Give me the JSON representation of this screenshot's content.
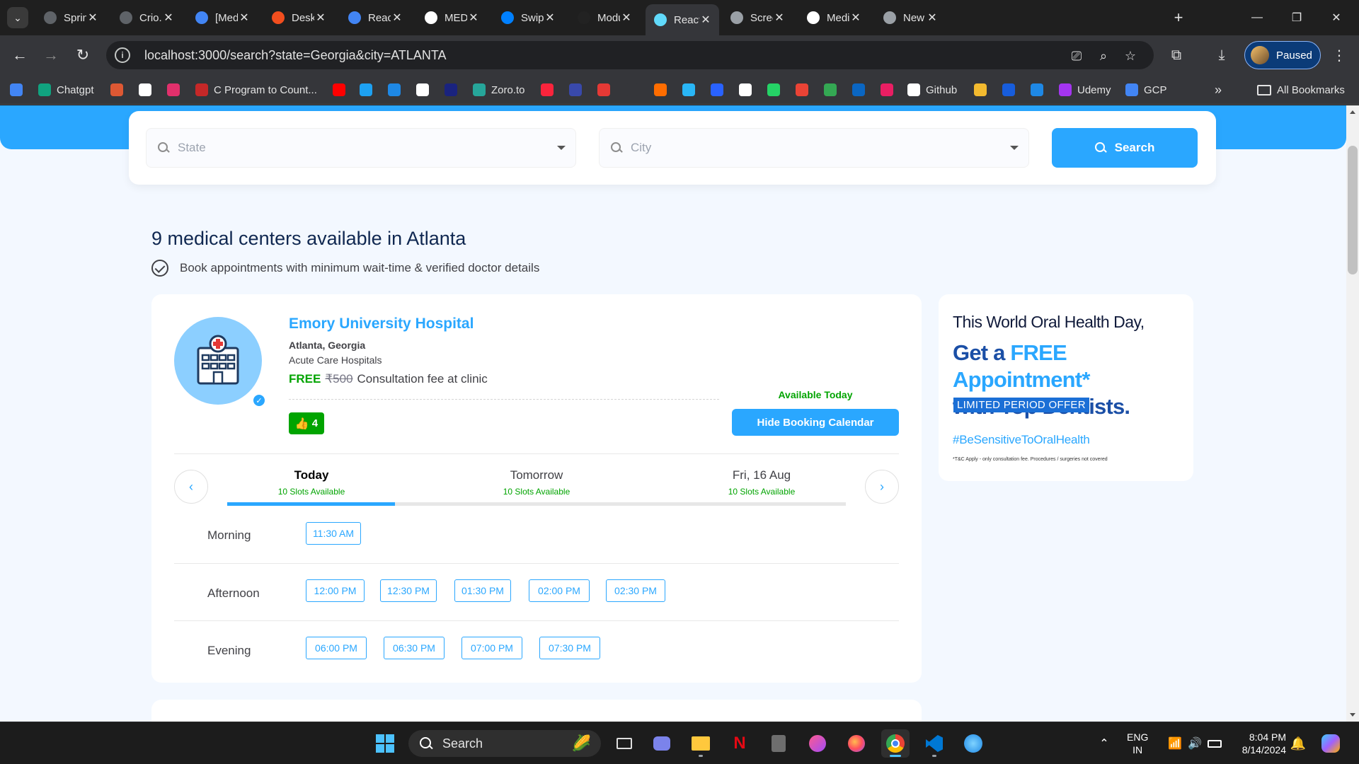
{
  "browser": {
    "tabs": [
      {
        "title": "Sprint",
        "icon": "generic-site-icon",
        "color": "#5f6368"
      },
      {
        "title": "Crio.Do",
        "icon": "generic-site-icon",
        "color": "#5f6368"
      },
      {
        "title": "[Medif",
        "icon": "google-docs-icon",
        "color": "#4285f4"
      },
      {
        "title": "Deskto",
        "icon": "figma-icon",
        "color": "#f24e1e"
      },
      {
        "title": "ReactJ",
        "icon": "google-docs-icon",
        "color": "#4285f4"
      },
      {
        "title": "MEDIF",
        "icon": "github-icon",
        "color": "#ffffff"
      },
      {
        "title": "Swiper",
        "icon": "swiper-icon",
        "color": "#0080ff"
      },
      {
        "title": "Modul",
        "icon": "generic-site-icon",
        "color": "#222222"
      },
      {
        "title": "React",
        "icon": "react-icon",
        "color": "#61dafb",
        "active": true
      },
      {
        "title": "Screen",
        "icon": "camera-icon",
        "color": "#9aa0a6"
      },
      {
        "title": "MediC",
        "icon": "github-icon",
        "color": "#ffffff"
      },
      {
        "title": "New Ta",
        "icon": "chrome-icon",
        "color": "#9aa0a6"
      }
    ],
    "url": "localhost:3000/search?state=Georgia&city=ATLANTA",
    "profile_label": "Paused",
    "bookmarks": [
      {
        "label": "",
        "icon": "google-icon",
        "color": "#4285f4"
      },
      {
        "label": "Chatgpt",
        "icon": "chatgpt-icon",
        "color": "#10a37f"
      },
      {
        "label": "",
        "icon": "duckduckgo-icon",
        "color": "#de5833"
      },
      {
        "label": "",
        "icon": "amazon-icon",
        "color": "#ffffff"
      },
      {
        "label": "",
        "icon": "instagram-icon",
        "color": "#e1306c"
      },
      {
        "label": "C Program to Count...",
        "icon": "tc-icon",
        "color": "#c62828"
      },
      {
        "label": "",
        "icon": "youtube-icon",
        "color": "#ff0000"
      },
      {
        "label": "",
        "icon": "twitter-icon",
        "color": "#1da1f2"
      },
      {
        "label": "",
        "icon": "play-icon",
        "color": "#1e88e5"
      },
      {
        "label": "",
        "icon": "site-icon",
        "color": "#ffffff"
      },
      {
        "label": "",
        "icon": "bh-icon",
        "color": "#1a237e"
      },
      {
        "label": "Zoro.to",
        "icon": "zoro-icon",
        "color": "#26a69a"
      },
      {
        "label": "",
        "icon": "music-icon",
        "color": "#fa243c"
      },
      {
        "label": "",
        "icon": "chart-icon",
        "color": "#3949ab"
      },
      {
        "label": "",
        "icon": "adobe-icon",
        "color": "#e53935"
      },
      {
        "label": "",
        "icon": "h-icon",
        "color": "#35363a"
      },
      {
        "label": "",
        "icon": "b-icon",
        "color": "#ff6d00"
      },
      {
        "label": "",
        "icon": "fly-icon",
        "color": "#29b6f6"
      },
      {
        "label": "",
        "icon": "kotlin-icon",
        "color": "#2962ff"
      },
      {
        "label": "",
        "icon": "w-icon",
        "color": "#ffffff"
      },
      {
        "label": "",
        "icon": "whatsapp-icon",
        "color": "#25d366"
      },
      {
        "label": "",
        "icon": "gmail-icon",
        "color": "#ea4335"
      },
      {
        "label": "",
        "icon": "drive-icon",
        "color": "#34a853"
      },
      {
        "label": "",
        "icon": "linkedin-icon",
        "color": "#0a66c2"
      },
      {
        "label": "",
        "icon": "swirl-icon",
        "color": "#e91e63"
      },
      {
        "label": "Github",
        "icon": "github-icon",
        "color": "#ffffff"
      },
      {
        "label": "",
        "icon": "binance-icon",
        "color": "#f3ba2f"
      },
      {
        "label": "",
        "icon": "bitwarden-icon",
        "color": "#175ddc"
      },
      {
        "label": "",
        "icon": "k-icon",
        "color": "#1e88e5"
      },
      {
        "label": "Udemy",
        "icon": "udemy-icon",
        "color": "#a435f0"
      },
      {
        "label": "GCP",
        "icon": "gcp-icon",
        "color": "#4285f4"
      }
    ],
    "all_bookmarks_label": "All Bookmarks"
  },
  "search": {
    "state_placeholder": "State",
    "city_placeholder": "City",
    "button_label": "Search"
  },
  "results": {
    "heading": "9 medical centers available in Atlanta",
    "subheading": "Book appointments with minimum wait-time & verified doctor details"
  },
  "center": {
    "name": "Emory University Hospital",
    "location": "Atlanta, Georgia",
    "type": "Acute Care Hospitals",
    "fee_free": "FREE",
    "fee_original": "₹500",
    "fee_text": "Consultation fee at clinic",
    "likes": "4",
    "availability": "Available Today",
    "calendar_button": "Hide Booking Calendar",
    "days": [
      {
        "label": "Today",
        "slots": "10 Slots Available"
      },
      {
        "label": "Tomorrow",
        "slots": "10 Slots Available"
      },
      {
        "label": "Fri, 16 Aug",
        "slots": "10 Slots Available"
      }
    ],
    "periods": [
      {
        "label": "Morning",
        "times": [
          "11:30 AM"
        ]
      },
      {
        "label": "Afternoon",
        "times": [
          "12:00 PM",
          "12:30 PM",
          "01:30 PM",
          "02:00 PM",
          "02:30 PM"
        ]
      },
      {
        "label": "Evening",
        "times": [
          "06:00 PM",
          "06:30 PM",
          "07:00 PM",
          "07:30 PM"
        ]
      }
    ]
  },
  "ad": {
    "line1": "This World Oral Health Day,",
    "line2a": "Get a ",
    "line2b": "FREE Appointment*",
    "line3": "with Top Dentists.",
    "badge": "LIMITED PERIOD OFFER",
    "hashtag": "#BeSensitiveToOralHealth",
    "fineprint": "*T&C Apply - only consultation fee. Procedures / surgeries not covered"
  },
  "taskbar": {
    "search_label": "Search",
    "lang_line1": "ENG",
    "lang_line2": "IN",
    "time": "8:04 PM",
    "date": "8/14/2024"
  }
}
